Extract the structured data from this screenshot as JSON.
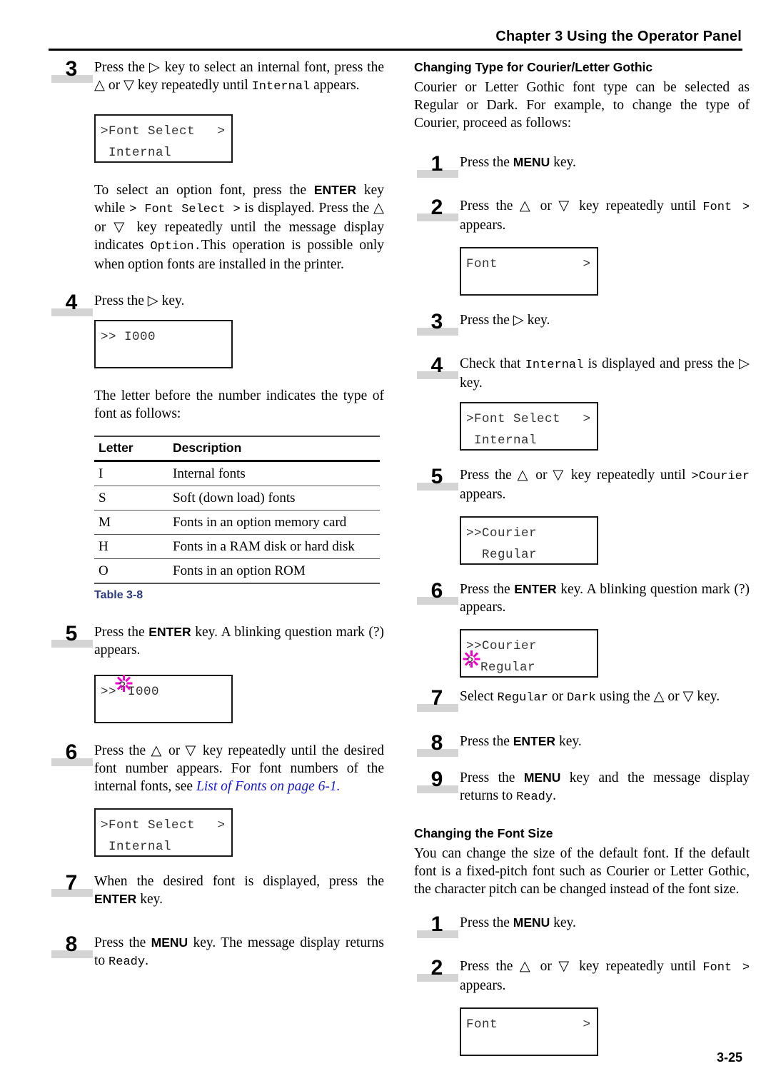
{
  "header": {
    "chapter_title": "Chapter 3  Using the Operator Panel"
  },
  "footer": {
    "page_number": "3-25"
  },
  "colors": {
    "accent_blue": "#2e3a80",
    "link_blue": "#1a1ad0",
    "blink_magenta": "#f000c8",
    "step_bar_gray": "#d4d4d4"
  },
  "left_column": {
    "step3": {
      "number": "3",
      "text_a": "Press the ",
      "key_right": "▷",
      "text_b": " key to select an internal font, press the ",
      "key_up": "△",
      "text_c": " or ",
      "key_down": "▽",
      "text_d": " key repeatedly until ",
      "mono1": "Internal",
      "text_e": " appears."
    },
    "lcd1": {
      "line1": ">Font Select",
      "line1_right": ">",
      "line2": " Internal"
    },
    "para_option": {
      "t1": "To select an option font, press the ",
      "b1": "ENTER",
      "t2": " key while ",
      "m1": "> Font Select >",
      "t3": " is displayed. Press the ",
      "k1": "△",
      "t4": " or ",
      "k2": "▽",
      "t5": " key repeatedly until the message display indicates ",
      "m2": "Option.",
      "t6": "This operation is possible only when option fonts are installed in the printer."
    },
    "step4": {
      "number": "4",
      "t1": "Press the ",
      "k1": "▷",
      "t2": " key."
    },
    "lcd2": {
      "line1": ">> I000",
      "line2": ""
    },
    "para_letter": "The letter before the number indicates the type of font as follows:",
    "table": {
      "caption": "Table 3-8",
      "columns": [
        "Letter",
        "Description"
      ],
      "rows": [
        [
          "I",
          "Internal fonts"
        ],
        [
          "S",
          "Soft (down load) fonts"
        ],
        [
          "M",
          "Fonts in an option memory card"
        ],
        [
          "H",
          "Fonts in a RAM disk or hard disk"
        ],
        [
          "O",
          "Fonts in an option ROM"
        ]
      ]
    },
    "step5": {
      "number": "5",
      "t1": "Press the ",
      "b1": "ENTER",
      "t2": " key. A blinking question mark (?) appears."
    },
    "lcd3": {
      "prefix": ">>",
      "blink_char": "?",
      "suffix": "I000"
    },
    "step6": {
      "number": "6",
      "t1": "Press the ",
      "k1": "△",
      "t2": " or ",
      "k2": "▽",
      "t3": " key repeatedly until the desired font number appears. For font numbers of the internal fonts, see ",
      "link": "List of Fonts on page 6-1."
    },
    "lcd4": {
      "line1": ">Font Select",
      "line1_right": ">",
      "line2": " Internal"
    },
    "step7": {
      "number": "7",
      "t1": "When the desired font is displayed, press the ",
      "b1": "ENTER",
      "t2": " key."
    },
    "step8": {
      "number": "8",
      "t1": "Press the ",
      "b1": "MENU",
      "t2": " key. The message display returns to ",
      "m1": "Ready",
      "t3": "."
    }
  },
  "right_column": {
    "section1": {
      "heading": "Changing Type for Courier/Letter Gothic",
      "intro": "Courier or Letter Gothic font type can be selected as Regular or Dark. For example, to change the type of Courier, proceed as follows:",
      "step1": {
        "number": "1",
        "t1": "Press the ",
        "b1": "MENU",
        "t2": " key."
      },
      "step2": {
        "number": "2",
        "t1": "Press the ",
        "k1": "△",
        "t2": " or ",
        "k2": "▽",
        "t3": " key repeatedly until ",
        "m1": "Font  >",
        "t4": " appears."
      },
      "lcd1": {
        "line1": "Font",
        "line1_right": ">",
        "line2": ""
      },
      "step3": {
        "number": "3",
        "t1": "Press the ",
        "k1": "▷",
        "t2": " key."
      },
      "step4": {
        "number": "4",
        "t1": "Check that ",
        "m1": "Internal",
        "t2": " is displayed and press the ",
        "k1": "▷",
        "t3": " key."
      },
      "lcd2": {
        "line1": ">Font Select",
        "line1_right": ">",
        "line2": " Internal"
      },
      "step5": {
        "number": "5",
        "t1": "Press the ",
        "k1": "△",
        "t2": " or ",
        "k2": "▽",
        "t3": " key repeatedly until ",
        "m1": ">Courier",
        "t4": " appears."
      },
      "lcd3": {
        "line1": ">>Courier",
        "line2": "  Regular"
      },
      "step6": {
        "number": "6",
        "t1": "Press the ",
        "b1": "ENTER",
        "t2": " key. A blinking question mark (?) appears."
      },
      "lcd4": {
        "line1": ">>Courier",
        "blink_char": "?",
        "line2_text": "Regular"
      },
      "step7": {
        "number": "7",
        "t1": "Select ",
        "m1": "Regular",
        "t2": " or ",
        "m2": "Dark",
        "t3": " using the ",
        "k1": "△",
        "t4": " or ",
        "k2": "▽",
        "t5": " key."
      },
      "step8": {
        "number": "8",
        "t1": "Press the ",
        "b1": "ENTER",
        "t2": " key."
      },
      "step9": {
        "number": "9",
        "t1": "Press the ",
        "b1": "MENU",
        "t2": " key and the message display returns to ",
        "m1": "Ready",
        "t3": "."
      }
    },
    "section2": {
      "heading": "Changing the Font Size",
      "intro": "You can change the size of the default font. If the default font is a fixed-pitch font such as Courier or Letter Gothic, the character pitch can be changed instead of the font size.",
      "step1": {
        "number": "1",
        "t1": "Press the ",
        "b1": "MENU",
        "t2": " key."
      },
      "step2": {
        "number": "2",
        "t1": "Press the ",
        "k1": "△",
        "t2": " or ",
        "k2": "▽",
        "t3": " key repeatedly until ",
        "m1": "Font  >",
        "t4": " appears."
      },
      "lcd1": {
        "line1": "Font",
        "line1_right": ">",
        "line2": ""
      }
    }
  }
}
